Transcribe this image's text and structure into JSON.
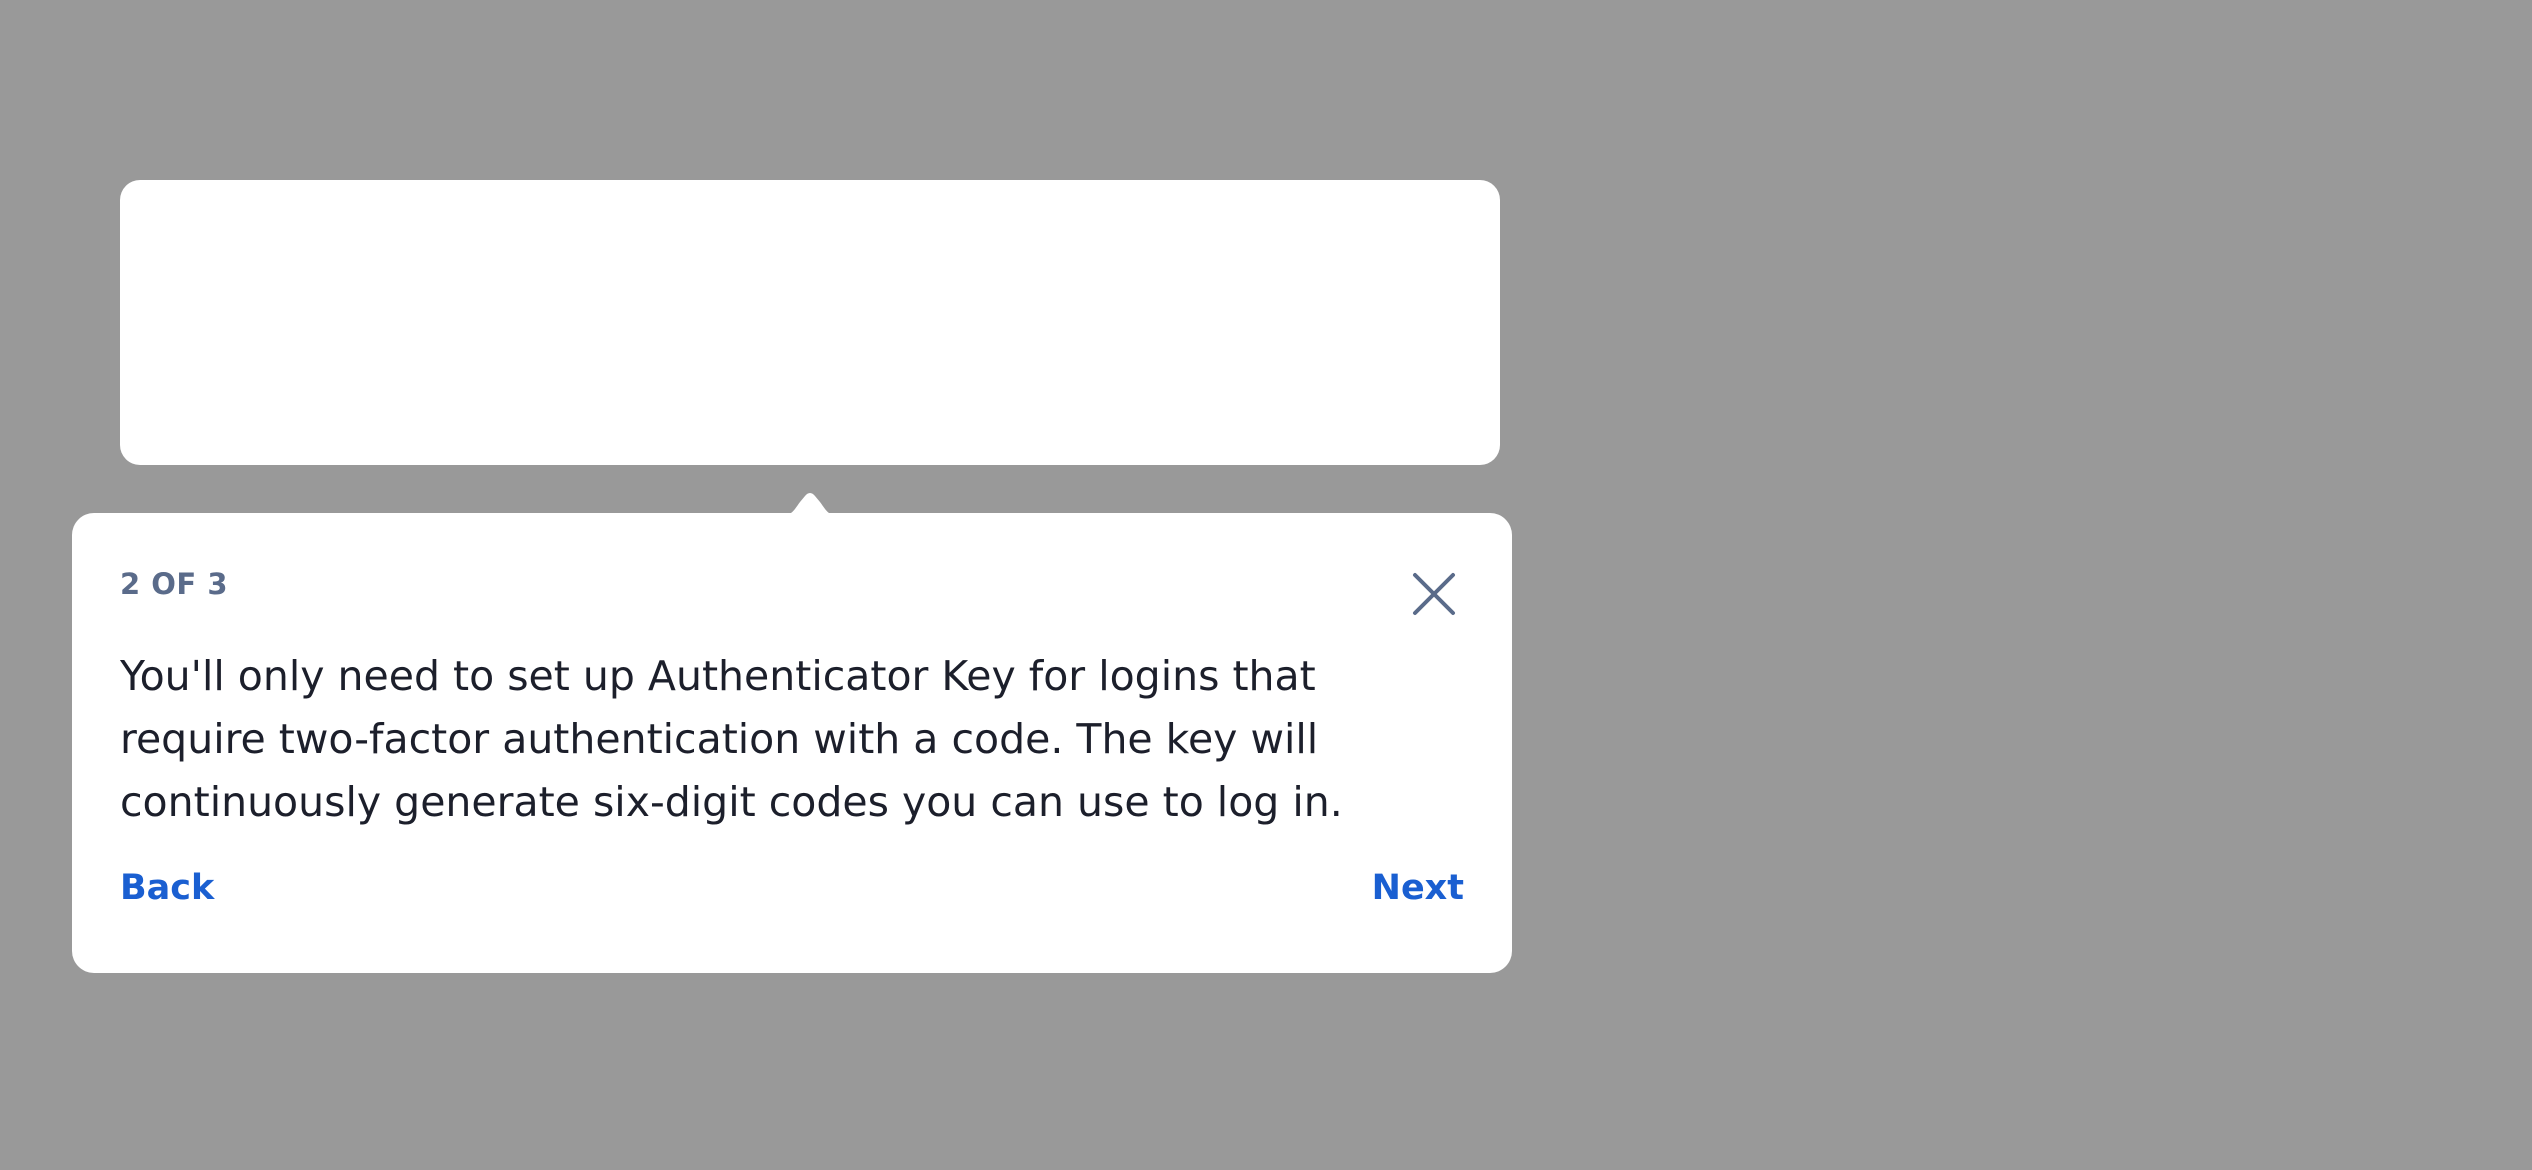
{
  "overlay": {
    "background_color": "#999999"
  },
  "tooltip": {
    "step_counter": "2 OF 3",
    "body_text": "You'll only need to set up Authenticator Key for logins that require two-factor authentication with a code. The key will continuously generate six-digit codes you can use to log in.",
    "close_icon": "close-icon",
    "back_label": "Back",
    "next_label": "Next",
    "link_color": "#1a5fd1",
    "counter_color": "#5a6b8a"
  }
}
